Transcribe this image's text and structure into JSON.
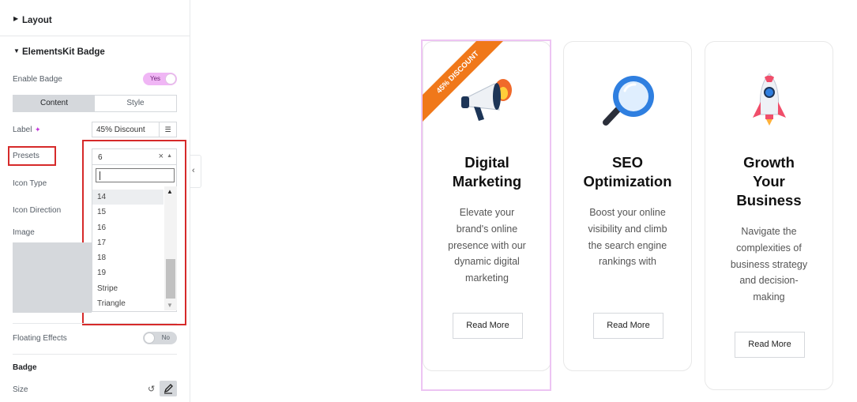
{
  "panel": {
    "layout_section": "Layout",
    "badge_section": "ElementsKit Badge",
    "enable_badge_label": "Enable Badge",
    "enable_badge_value": "Yes",
    "tabs": [
      {
        "label": "Content"
      },
      {
        "label": "Style"
      }
    ],
    "label_label": "Label",
    "label_value": "45% Discount",
    "presets_label": "Presets",
    "presets_value": "6",
    "presets_clear": "×",
    "icon_type_label": "Icon Type",
    "icon_direction_label": "Icon Direction",
    "image_label": "Image",
    "dropdown_options": [
      "14",
      "15",
      "16",
      "17",
      "18",
      "19",
      "Stripe",
      "Triangle"
    ],
    "dropdown_highlighted": "14",
    "floating_effects_label": "Floating Effects",
    "floating_effects_value": "No",
    "badge_heading": "Badge",
    "size_label": "Size"
  },
  "cards": [
    {
      "title": "Digital Marketing",
      "description": "Elevate your brand's online presence with our dynamic digital marketing",
      "button": "Read More",
      "icon": "megaphone-icon",
      "badge": "45% DISCOUNT"
    },
    {
      "title": "SEO Optimization",
      "description": "Boost your online visibility and climb the search engine rankings with",
      "button": "Read More",
      "icon": "magnifier-icon"
    },
    {
      "title": "Growth Your Business",
      "description": "Navigate the complexities of business strategy and decision-making",
      "button": "Read More",
      "icon": "rocket-icon"
    }
  ],
  "colors": {
    "badge_ribbon": "#f0781a",
    "toggle_on": "#f0b6f5",
    "selection_frame": "#edc4f3",
    "highlight_box": "#d62a2a"
  }
}
